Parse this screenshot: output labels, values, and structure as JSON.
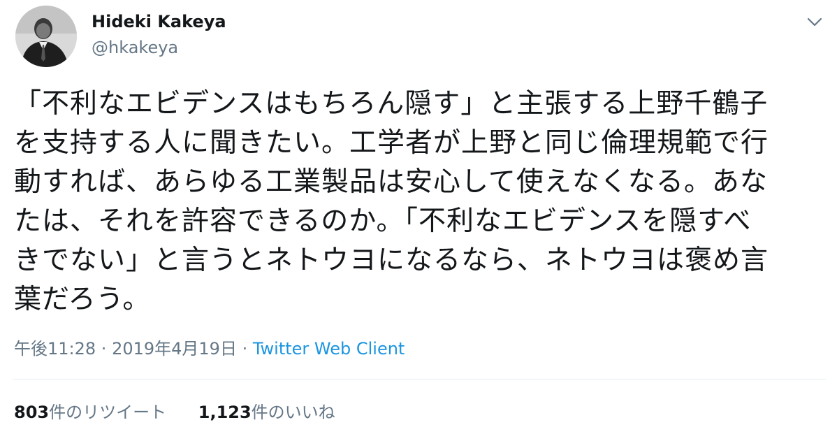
{
  "author": {
    "name": "Hideki Kakeya",
    "handle": "@hkakeya",
    "avatar_icon": "person-avatar-icon"
  },
  "menu": {
    "icon": "chevron-down-icon"
  },
  "tweet": {
    "lines": [
      "「不利なエビデンスはもちろん隠す」と主張する上野千鶴子",
      "を支持する人に聞きたい。工学者が上野と同じ倫理規範で行",
      "動すれば、あらゆる工業製品は安心して使えなくなる。あな",
      "たは、それを許容できるのか。「不利なエビデンスを隠すべ",
      "きでない」と言うとネトウヨになるなら、ネトウヨは褒め言",
      "葉だろう。"
    ]
  },
  "meta": {
    "time": "午後11:28",
    "separator1": " · ",
    "date": "2019年4月19日",
    "separator2": " · ",
    "source": "Twitter Web Client"
  },
  "stats": {
    "retweets_count": "803",
    "retweets_label": "件のリツイート",
    "likes_count": "1,123",
    "likes_label": "件のいいね"
  },
  "colors": {
    "text": "#14171a",
    "secondary": "#657786",
    "link": "#1b95e0",
    "divider": "#e6ecf0"
  }
}
